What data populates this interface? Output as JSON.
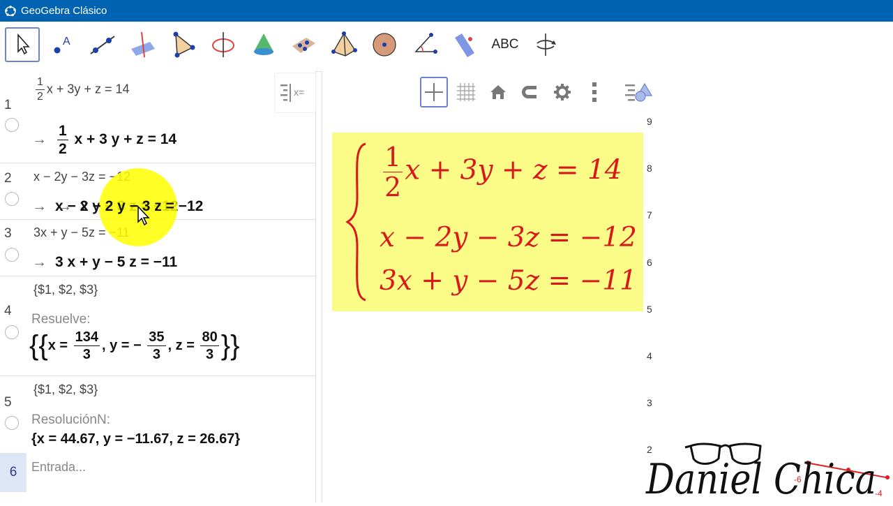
{
  "window": {
    "title": "GeoGebra Clásico"
  },
  "toolbar": {
    "tools": [
      "move-tool",
      "point-tool",
      "line-tool",
      "perpendicular-tool",
      "polygon-tool",
      "circle-tool",
      "cone-tool",
      "plane-tool",
      "points-tool",
      "pyramid-tool",
      "sphere-tool",
      "angle-tool",
      "reflect-tool",
      "text-tool",
      "rotate-view-tool"
    ],
    "text_tool_label": "ABC"
  },
  "algebra": {
    "rows": [
      {
        "num": "1",
        "input": "x + 3y + z  =  14",
        "input_frac": [
          "1",
          "2"
        ],
        "output": "x + 3 y + z = 14",
        "output_frac": [
          "1",
          "2"
        ]
      },
      {
        "num": "2",
        "input": "x − 2y − 3z  =  −12",
        "output": "x − 2 y − 3 z = −12"
      },
      {
        "num": "3",
        "input": "3x + y − 5z  =  −11",
        "output": "3 x + y − 5 z = −11"
      },
      {
        "num": "4",
        "input": "{$1, $2, $3}",
        "command": "Resuelve:",
        "result": {
          "x_label": "x =",
          "x_num": "134",
          "x_den": "3",
          "y_label": ", y = −",
          "y_num": "35",
          "y_den": "3",
          "z_label": ", z =",
          "z_num": "80",
          "z_den": "3"
        }
      },
      {
        "num": "5",
        "input": "{$1, $2, $3}",
        "command": "ResoluciónN:",
        "output": "{x = 44.67, y = −11.67, z = 26.67}"
      }
    ],
    "entry": {
      "num": "6",
      "placeholder": "Entrada..."
    }
  },
  "graphics": {
    "system": {
      "eq1_frac": [
        "1",
        "2"
      ],
      "eq1": "x + 3y + z = 14",
      "eq2": "x − 2y − 3z = −12",
      "eq3": "3x + y − 5z = −11"
    },
    "y_ticks": [
      "9",
      "8",
      "7",
      "6",
      "5",
      "4",
      "3",
      "2"
    ],
    "x_ticks": [
      "-6",
      "-4"
    ]
  },
  "watermark": "Daniel Chica",
  "colors": {
    "titlebar": "#0063b1",
    "equation": "#d7191c",
    "highlight": "#fbfb88",
    "cursor_highlight": "#ffff00"
  }
}
